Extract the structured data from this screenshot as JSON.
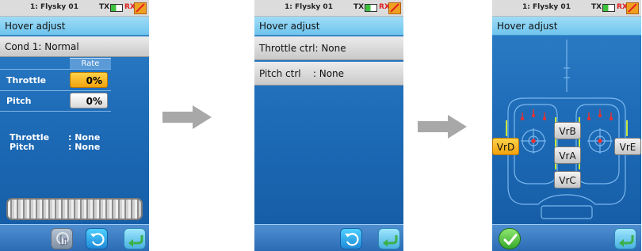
{
  "status": {
    "model": "1: Flysky 01",
    "tx": "TX",
    "rx": "RX"
  },
  "screen1": {
    "title": "Hover adjust",
    "condition": "Cond 1: Normal",
    "rate_header": "Rate",
    "rows": [
      {
        "label": "Throttle",
        "value": "0%"
      },
      {
        "label": "Pitch",
        "value": "0%"
      }
    ],
    "info": [
      {
        "label": "Throttle",
        "value": ": None"
      },
      {
        "label": "Pitch",
        "value": ": None"
      }
    ]
  },
  "screen2": {
    "title": "Hover adjust",
    "items": [
      "Throttle ctrl: None",
      "Pitch ctrl    : None"
    ]
  },
  "screen3": {
    "title": "Hover adjust",
    "knobs": [
      "VrB",
      "VrA",
      "VrC",
      "VrD",
      "VrE"
    ]
  },
  "colors": {
    "accent_orange": "#f2a20c",
    "header_blue": "#6fc4ee",
    "screen_blue": "#1e6cb8",
    "arrow_gray": "#a8a8a8"
  },
  "icons": [
    "battery-icon",
    "no-signal-icon",
    "touch-icon",
    "undo-icon",
    "back-icon",
    "confirm-icon",
    "arrow-right-icon"
  ]
}
